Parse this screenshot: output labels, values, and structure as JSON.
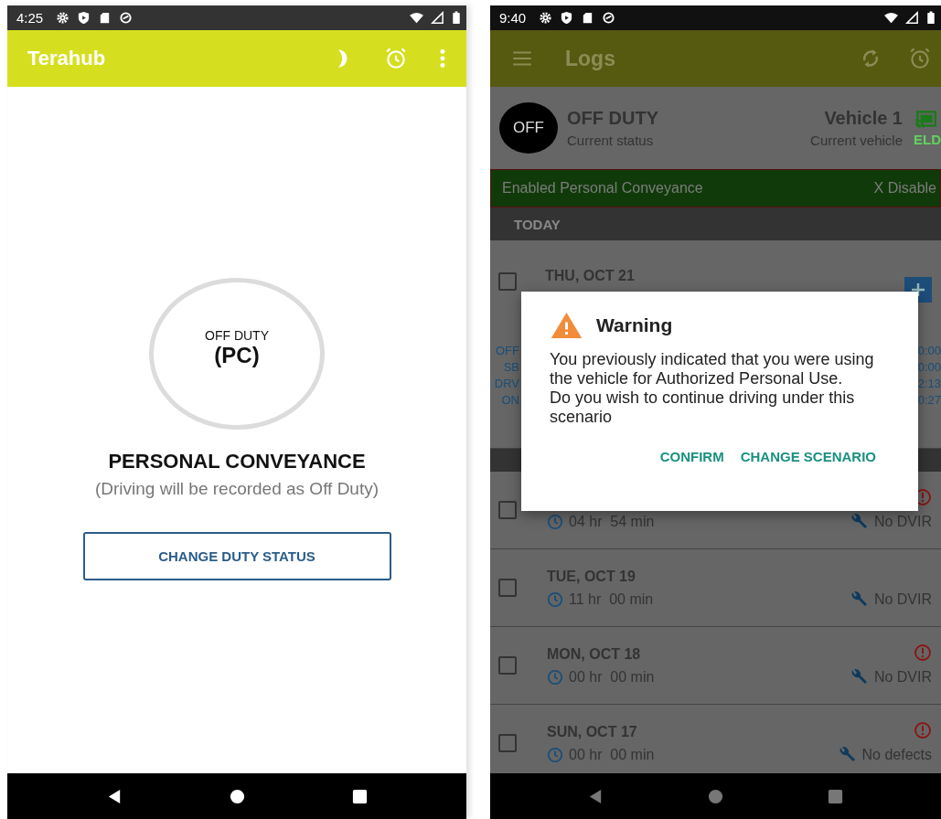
{
  "left_phone": {
    "status_bar": {
      "time": "4:25"
    },
    "app_bar": {
      "title": "Terahub"
    },
    "duty_circle": {
      "label": "OFF DUTY",
      "code": "(PC)"
    },
    "heading": "PERSONAL CONVEYANCE",
    "note": "(Driving will be recorded as Off Duty)",
    "button": "CHANGE DUTY STATUS"
  },
  "right_phone": {
    "status_bar": {
      "time": "9:40"
    },
    "app_bar": {
      "title": "Logs"
    },
    "current": {
      "badge": "OFF",
      "status": "OFF DUTY",
      "status_label": "Current status",
      "vehicle": "Vehicle 1",
      "vehicle_label": "Current vehicle",
      "eld": "ELD"
    },
    "banner": {
      "text": "Enabled Personal Conveyance",
      "action": "X Disable"
    },
    "section": "TODAY",
    "today": {
      "date": "THU, OCT 21",
      "checked": false,
      "stats": [
        {
          "label": "OFF",
          "value": "0:00"
        },
        {
          "label": "SB",
          "value": "0:00"
        },
        {
          "label": "DRV",
          "value": "2:13"
        },
        {
          "label": "ON",
          "value": "0:27"
        }
      ]
    },
    "logs": [
      {
        "duration": "04 hr  54 min",
        "dvir": "No DVIR",
        "checked": false,
        "violation": true
      },
      {
        "date": "TUE, OCT 19",
        "duration": "11 hr  00 min",
        "dvir": "No DVIR",
        "checked": false,
        "violation": false
      },
      {
        "date": "MON, OCT 18",
        "duration": "00 hr  00 min",
        "dvir": "No DVIR",
        "checked": false,
        "violation": true
      },
      {
        "date": "SUN, OCT 17",
        "duration": "00 hr  00 min",
        "dvir": "No defects",
        "checked": false,
        "violation": true
      }
    ],
    "dialog": {
      "title": "Warning",
      "message": [
        "You previously indicated that you were using the vehicle for Authorized Personal Use.",
        "Do you wish to continue driving under this scenario"
      ],
      "buttons": [
        "CONFIRM",
        "CHANGE SCENARIO"
      ]
    }
  }
}
